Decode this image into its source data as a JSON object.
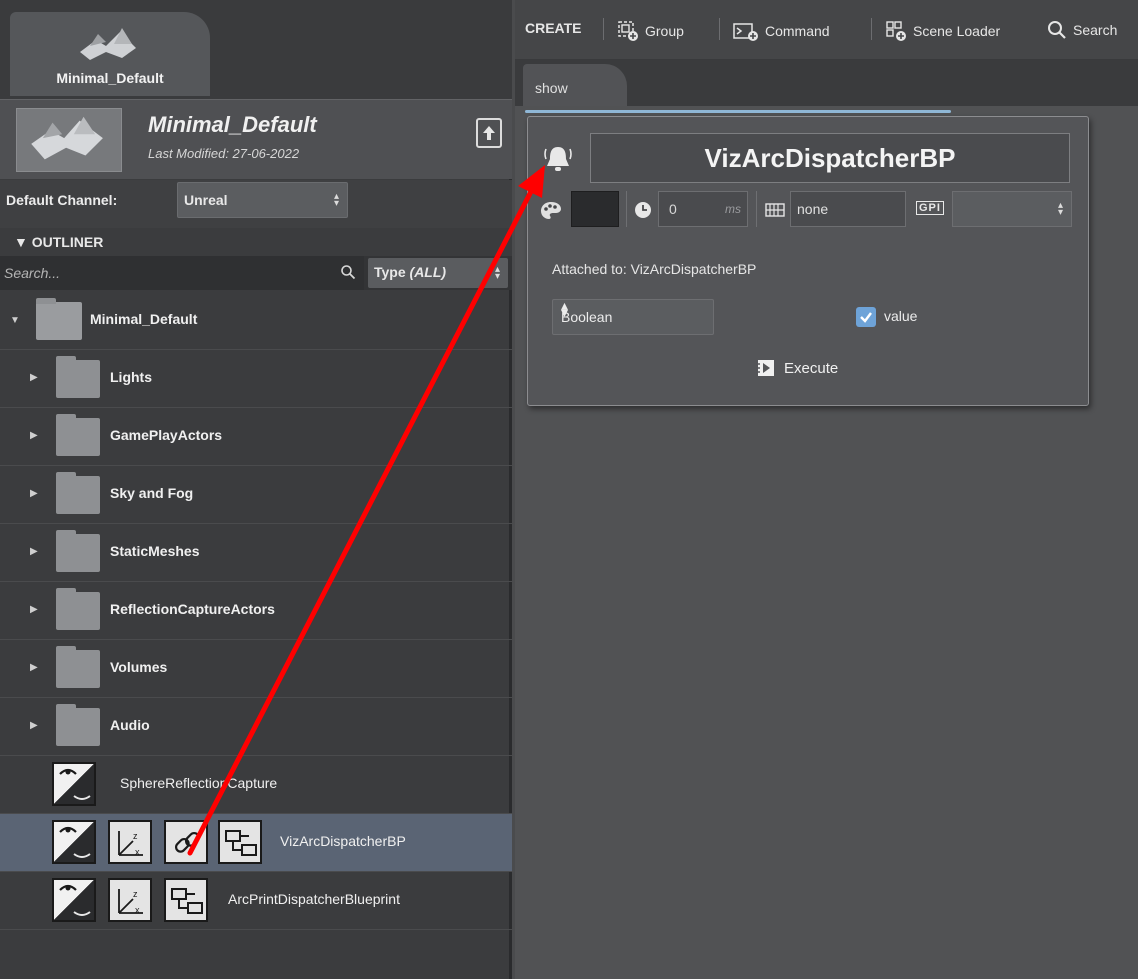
{
  "project": {
    "tab_name": "Minimal_Default",
    "title": "Minimal_Default",
    "last_modified": "Last Modified: 27-06-2022",
    "channel_label": "Default Channel:",
    "channel_value": "Unreal"
  },
  "outliner": {
    "header": "▼ OUTLINER",
    "search_placeholder": "Search...",
    "type_label": "Type",
    "type_value": "(ALL)",
    "root": "Minimal_Default",
    "folders": [
      "Lights",
      "GamePlayActors",
      "Sky and Fog",
      "StaticMeshes",
      "ReflectionCaptureActors",
      "Volumes",
      "Audio"
    ],
    "actors": [
      "SphereReflectionCapture",
      "VizArcDispatcherBP",
      "ArcPrintDispatcherBlueprint"
    ]
  },
  "toolbar": {
    "create": "CREATE",
    "group": "Group",
    "command": "Command",
    "scene_loader": "Scene Loader",
    "search": "Search"
  },
  "canvas_tab": "show",
  "command_card": {
    "title": "VizArcDispatcherBP",
    "delay_value": "0",
    "delay_unit": "ms",
    "keyframe_value": "none",
    "gpi_label": "GPI",
    "attached_to": "Attached to: VizArcDispatcherBP",
    "type": "Boolean",
    "value_label": "value",
    "value_checked": true,
    "execute": "Execute"
  },
  "colors": {
    "annotation_arrow": "#ff0000",
    "selected_row": "#5a6474",
    "checkbox": "#6ea3d8"
  }
}
